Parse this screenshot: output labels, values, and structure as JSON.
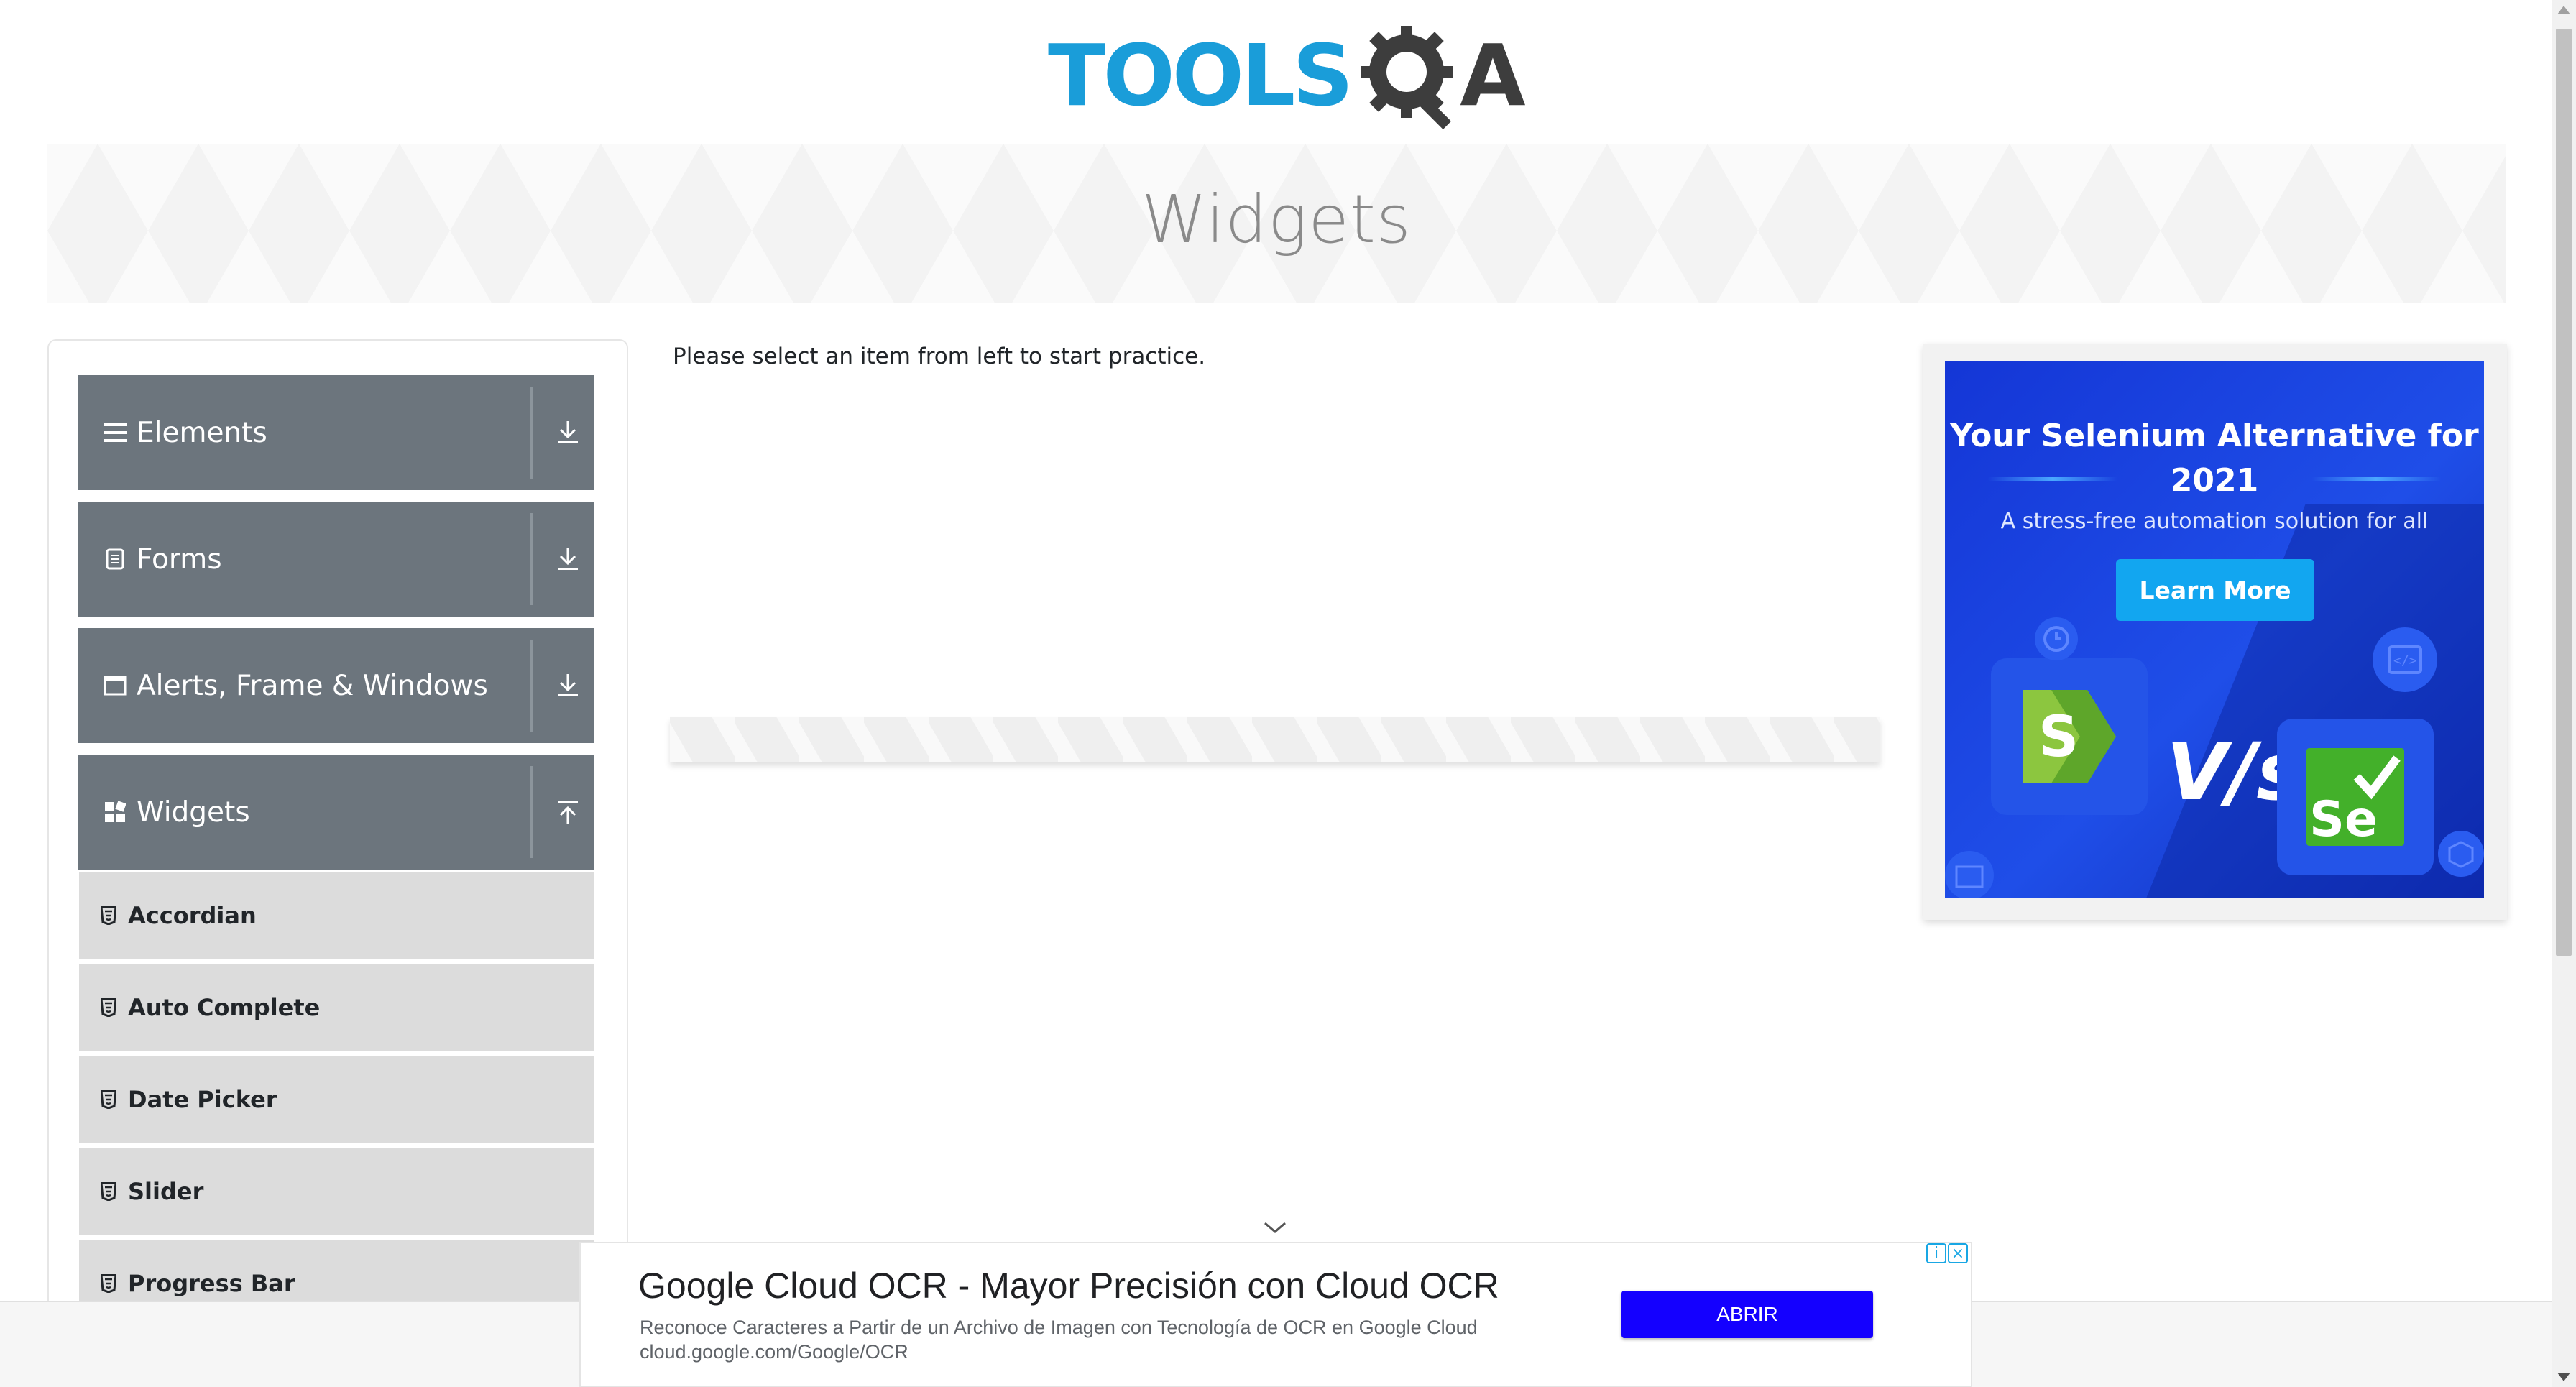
{
  "header": {
    "logo_text": "TOOLSQA",
    "logo_word": "TOOLS",
    "logo_letter": "A"
  },
  "banner": {
    "title": "Widgets"
  },
  "sidebar": {
    "groups": [
      {
        "label": "Elements",
        "icon": "menu-icon",
        "arrow": "download-arrow-icon"
      },
      {
        "label": "Forms",
        "icon": "document-icon",
        "arrow": "download-arrow-icon"
      },
      {
        "label": "Alerts, Frame & Windows",
        "icon": "window-icon",
        "arrow": "download-arrow-icon"
      },
      {
        "label": "Widgets",
        "icon": "widgets-grid-icon",
        "arrow": "upload-arrow-icon"
      }
    ],
    "items": [
      {
        "label": "Accordian",
        "icon": "html5-icon"
      },
      {
        "label": "Auto Complete",
        "icon": "html5-icon"
      },
      {
        "label": "Date Picker",
        "icon": "html5-icon"
      },
      {
        "label": "Slider",
        "icon": "html5-icon"
      },
      {
        "label": "Progress Bar",
        "icon": "html5-icon"
      }
    ]
  },
  "main": {
    "prompt": "Please select an item from left to start practice."
  },
  "right_ad": {
    "title": "Your Selenium Alternative for 2021",
    "subtitle": "A stress-free automation solution for all",
    "button": "Learn More",
    "vs": "V/s",
    "logo1": "S",
    "logo2": "Se"
  },
  "bottom_ad": {
    "title": "Google Cloud OCR - Mayor Precisión con Cloud OCR",
    "description": "Reconoce Caracteres a Partir de un Archivo de Imagen con Tecnología de OCR en Google Cloud",
    "url": "cloud.google.com/Google/OCR",
    "button": "ABRIR"
  },
  "colors": {
    "logo_blue": "#1a9dd9",
    "logo_dark": "#3d3d3d",
    "sidebar_group": "#6c757d",
    "sidebar_item": "#dcdcdc",
    "ad_blue": "#1f4ee8",
    "ad_button": "#12a6f0",
    "bottom_ad_button": "#1400ff"
  }
}
